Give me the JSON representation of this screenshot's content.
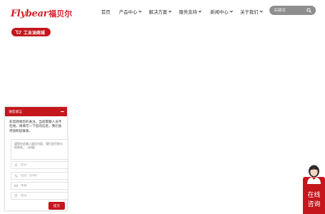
{
  "header": {
    "logo_text": "Flybear",
    "logo_cn": "福贝尔",
    "nav": [
      {
        "label": "首页",
        "dropdown": false
      },
      {
        "label": "产品中心",
        "dropdown": true
      },
      {
        "label": "解决方案",
        "dropdown": true
      },
      {
        "label": "服务支持",
        "dropdown": true
      },
      {
        "label": "新闻中心",
        "dropdown": true
      },
      {
        "label": "关于我们",
        "dropdown": true
      }
    ],
    "search": {
      "placeholder": "关键词",
      "icon": "search-icon"
    },
    "mall_button": {
      "label": "工业油商城",
      "icon": "cart-icon"
    }
  },
  "message_panel": {
    "title": "请您留言",
    "intro": "非常感谢您的关注，当前客服人员不在线，请填写一下您的信息，我们会尽快和您联系。",
    "textarea_placeholder": "请您在此输入留言内容，我们会尽快与您联系。（必填）",
    "fields": [
      {
        "placeholder": "姓名",
        "icon": "user-icon"
      },
      {
        "placeholder": "电话（必填）",
        "icon": "phone-icon"
      },
      {
        "placeholder": "邮箱",
        "icon": "mail-icon"
      },
      {
        "placeholder": "地址",
        "icon": "location-icon"
      }
    ],
    "submit_label": "提交"
  },
  "consult": {
    "line1": "在线",
    "line2": "咨询"
  },
  "colors": {
    "brand": "#c4161c",
    "search_bg": "#8e8e8e"
  }
}
